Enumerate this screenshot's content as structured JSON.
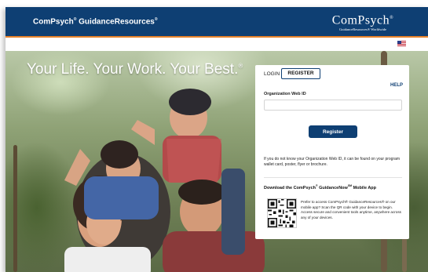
{
  "header": {
    "app_name": "ComPsych",
    "app_name_mark": "®",
    "app_name_rest": " GuidanceResources",
    "app_name_mark2": "®",
    "brand_logo": "ComPsych",
    "brand_logo_mark": "®",
    "brand_sub": "GuidanceResources® Worldwide",
    "language_flag_icon": "us-flag-icon"
  },
  "hero": {
    "headline": "Your Life. Your Work. Your Best.",
    "headline_mark": "®"
  },
  "login_panel": {
    "tab_login": "LOGIN",
    "tab_register": "REGISTER",
    "help_link": "HELP",
    "org_id_label": "Organization Web ID",
    "org_id_value": "",
    "register_button": "Register",
    "org_id_help": "If you do not know your Organization Web ID, it can be found on your program wallet card, poster, flyer or brochure.",
    "app_heading": "Download the ComPsych",
    "app_heading_mark1": "®",
    "app_heading_mid": " GuidanceNow",
    "app_heading_mark2": "SM",
    "app_heading_end": " Mobile App",
    "app_text": "Prefer to access ComPsych® GuidanceResources® on our mobile app? Scan the QR code with your device to begin. Access secure and convenient tools anytime, anywhere across any of your devices.",
    "qr_icon": "qr-code-icon"
  },
  "colors": {
    "header_bg": "#0e3f73",
    "accent_rule": "#e8832a",
    "button_bg": "#0e3f73"
  }
}
